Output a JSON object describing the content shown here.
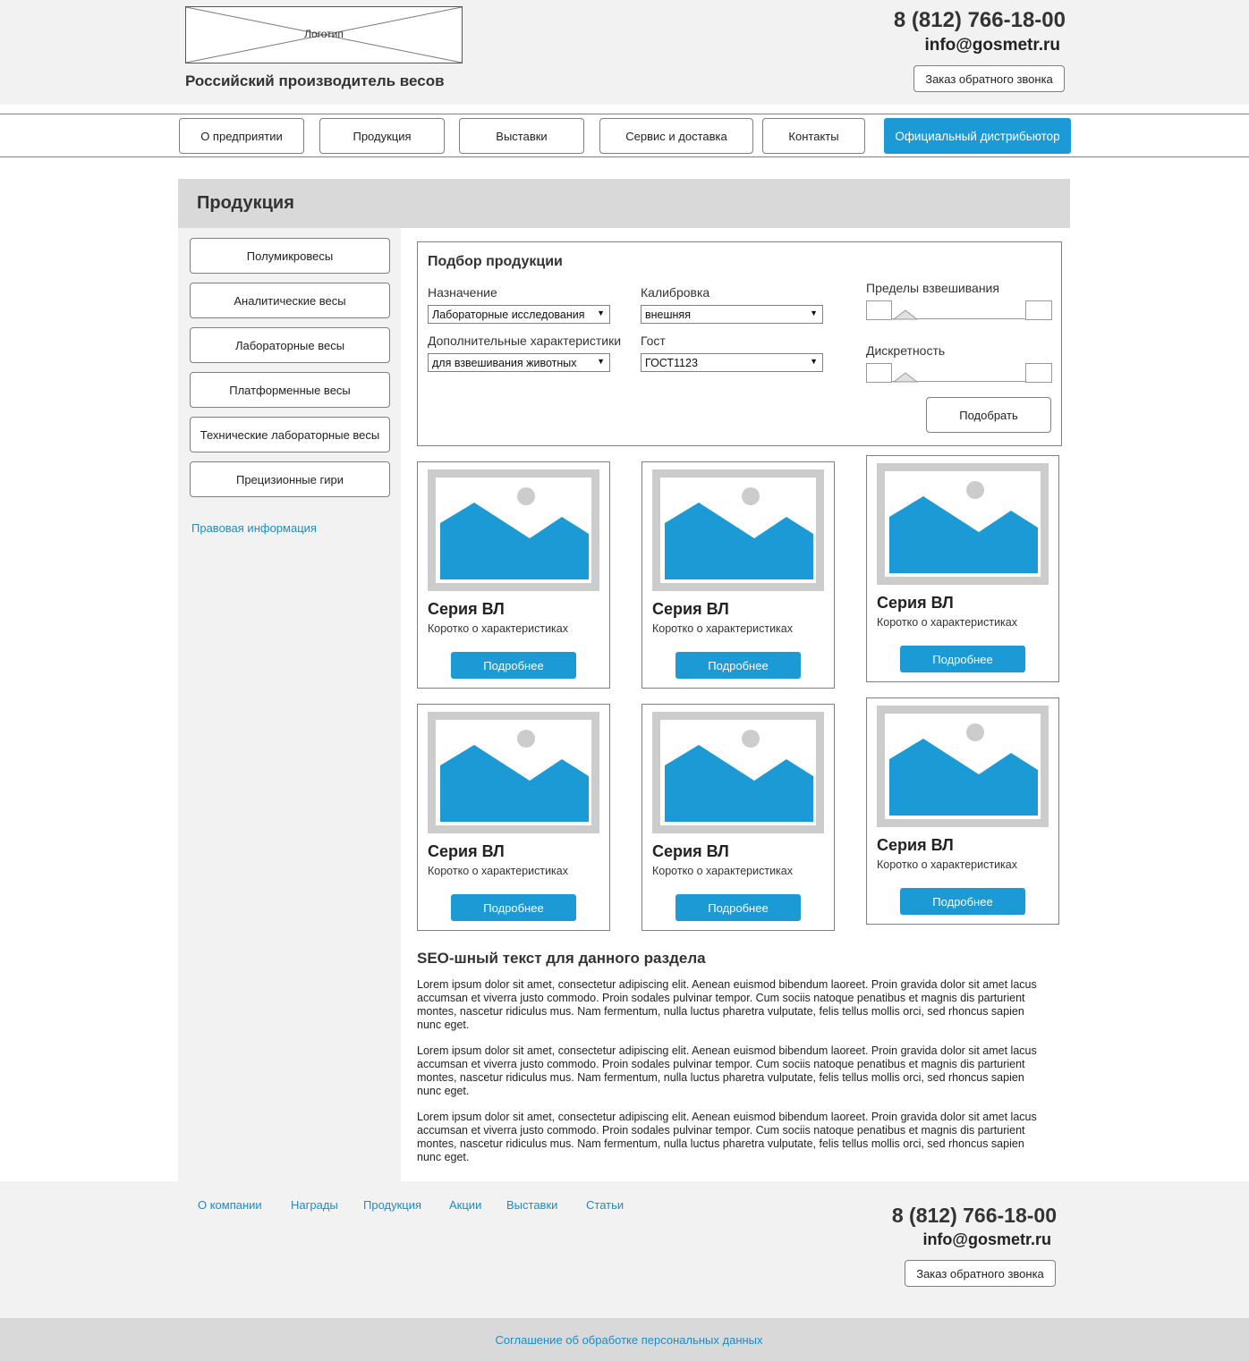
{
  "header": {
    "logo_label": "Логотип",
    "tagline": "Российский производитель весов",
    "phone": "8 (812) 766-18-00",
    "email": "info@gosmetr.ru",
    "callback_button": "Заказ обратного звонка"
  },
  "nav": {
    "items": [
      "О предприятии",
      "Продукция",
      "Выставки",
      "Сервис и доставка",
      "Контакты"
    ],
    "distributor_button": "Официальный дистрибьютор"
  },
  "page_title": "Продукция",
  "sidebar": {
    "items": [
      "Полумикровесы",
      "Аналитические весы",
      "Лабораторные весы",
      "Платформенные весы",
      "Технические лабораторные весы",
      "Прецизионные гири"
    ],
    "legal_link": "Правовая информация"
  },
  "filter": {
    "title": "Подбор продукции",
    "purpose_label": "Назначение",
    "purpose_value": "Лабораторные исследования",
    "calibration_label": "Калибровка",
    "calibration_value": "внешняя",
    "extra_label": "Дополнительные характеристики",
    "extra_value": "для взвешивания животных",
    "gost_label": "Гост",
    "gost_value": "ГОСТ1123",
    "limits_label": "Пределы взвешивания",
    "discreteness_label": "Дискретность",
    "submit_button": "Подобрать"
  },
  "products": [
    {
      "title": "Серия ВЛ",
      "desc": "Коротко о характеристиках",
      "button": "Подробнее"
    },
    {
      "title": "Серия ВЛ",
      "desc": "Коротко о характеристиках",
      "button": "Подробнее"
    },
    {
      "title": "Серия ВЛ",
      "desc": "Коротко о характеристиках",
      "button": "Подробнее"
    },
    {
      "title": "Серия ВЛ",
      "desc": "Коротко о характеристиках",
      "button": "Подробнее"
    },
    {
      "title": "Серия ВЛ",
      "desc": "Коротко о характеристиках",
      "button": "Подробнее"
    },
    {
      "title": "Серия ВЛ",
      "desc": "Коротко о характеристиках",
      "button": "Подробнее"
    }
  ],
  "seo": {
    "title": "SEO-шный текст для данного раздела",
    "paragraphs": [
      "Lorem ipsum dolor sit amet, consectetur adipiscing elit. Aenean euismod bibendum laoreet. Proin gravida dolor sit amet lacus accumsan et viverra justo commodo. Proin sodales pulvinar tempor. Cum sociis natoque penatibus et magnis dis parturient montes, nascetur ridiculus mus. Nam fermentum, nulla luctus pharetra vulputate, felis tellus mollis orci, sed rhoncus sapien nunc eget.",
      "Lorem ipsum dolor sit amet, consectetur adipiscing elit. Aenean euismod bibendum laoreet. Proin gravida dolor sit amet lacus accumsan et viverra justo commodo. Proin sodales pulvinar tempor. Cum sociis natoque penatibus et magnis dis parturient montes, nascetur ridiculus mus. Nam fermentum, nulla luctus pharetra vulputate, felis tellus mollis orci, sed rhoncus sapien nunc eget.",
      "Lorem ipsum dolor sit amet, consectetur adipiscing elit. Aenean euismod bibendum laoreet. Proin gravida dolor sit amet lacus accumsan et viverra justo commodo. Proin sodales pulvinar tempor. Cum sociis natoque penatibus et magnis dis parturient montes, nascetur ridiculus mus. Nam fermentum, nulla luctus pharetra vulputate, felis tellus mollis orci, sed rhoncus sapien nunc eget."
    ]
  },
  "footer": {
    "links": [
      "О компании",
      "Награды",
      "Продукция",
      "Акции",
      "Выставки",
      "Статьи"
    ],
    "phone": "8 (812) 766-18-00",
    "email": "info@gosmetr.ru",
    "callback_button": "Заказ обратного звонка",
    "agreement_link": "Соглашение об обработке персональных данных"
  },
  "colors": {
    "accent": "#1b9ad6",
    "link": "#1b8dc8",
    "header_bg": "#f2f2f2",
    "title_bar_bg": "#d9d9d9"
  }
}
